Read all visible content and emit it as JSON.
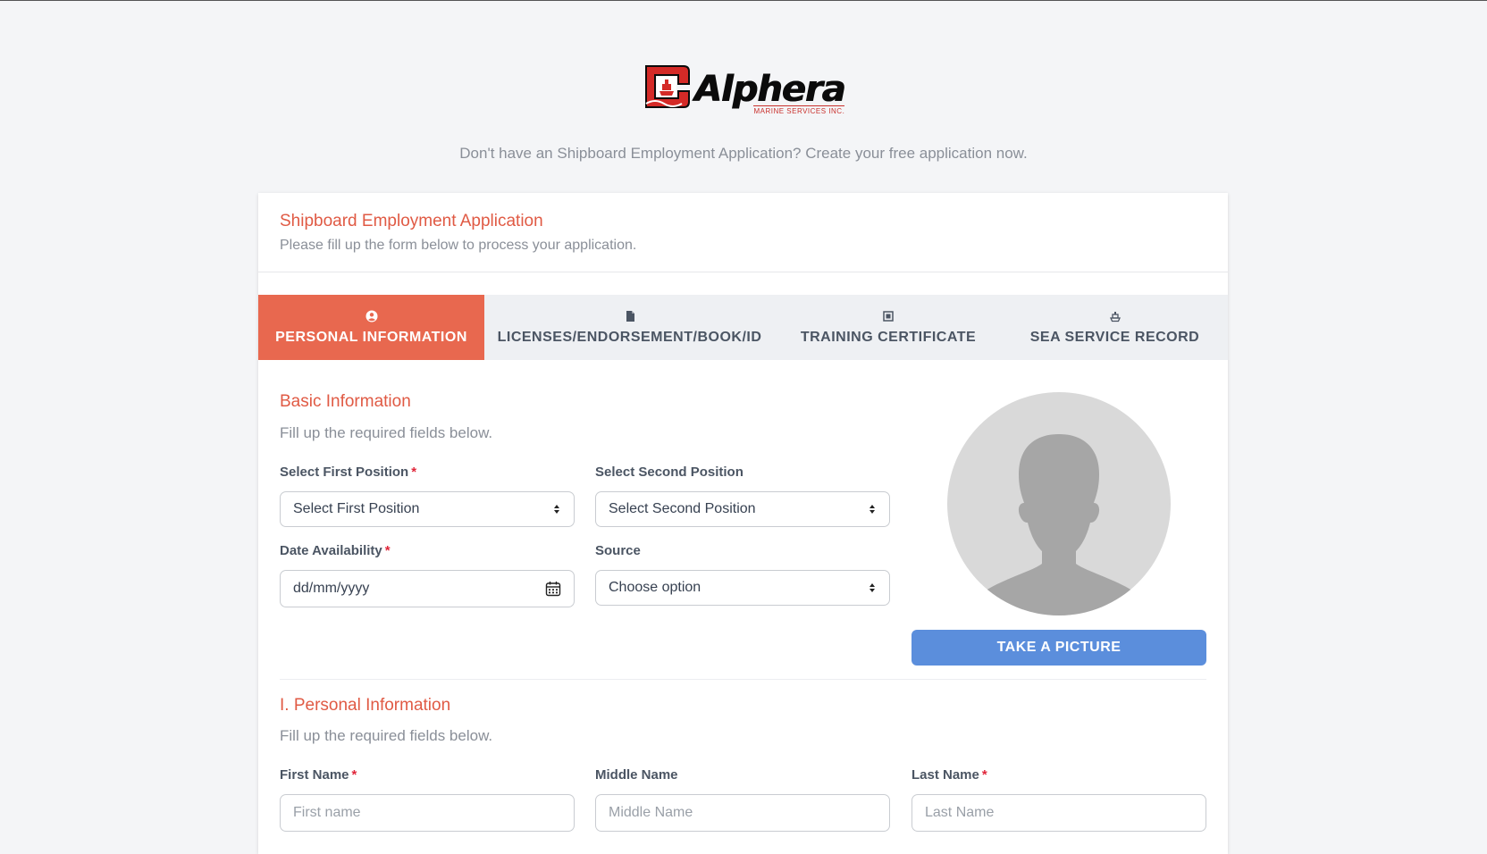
{
  "brand": {
    "name": "Alphera",
    "subname": "MARINE SERVICES INC.",
    "colors": {
      "red": "#d42a27",
      "black": "#0b0b0b"
    }
  },
  "tagline": "Don't have an Shipboard Employment Application? Create your free application now.",
  "card": {
    "title": "Shipboard Employment Application",
    "subtitle": "Please fill up the form below to process your application."
  },
  "tabs": [
    {
      "label": "PERSONAL INFORMATION",
      "icon": "user-circle-icon",
      "active": true
    },
    {
      "label": "LICENSES/ENDORSEMENT/BOOK/ID",
      "icon": "document-icon",
      "active": false
    },
    {
      "label": "TRAINING CERTIFICATE",
      "icon": "certificate-icon",
      "active": false
    },
    {
      "label": "SEA SERVICE RECORD",
      "icon": "ship-icon",
      "active": false
    }
  ],
  "basic": {
    "title": "Basic Information",
    "subtitle": "Fill up the required fields below.",
    "first_position": {
      "label": "Select First Position",
      "required": "*",
      "value": "Select First Position"
    },
    "second_position": {
      "label": "Select Second Position",
      "value": "Select Second Position"
    },
    "date_availability": {
      "label": "Date Availability",
      "required": "*",
      "value": "dd/mm/yyyy"
    },
    "source": {
      "label": "Source",
      "value": "Choose option"
    },
    "take_picture": "TAKE A PICTURE"
  },
  "personal": {
    "title": "I. Personal Information",
    "subtitle": "Fill up the required fields below.",
    "first_name": {
      "label": "First Name",
      "required": "*",
      "placeholder": "First name"
    },
    "middle_name": {
      "label": "Middle Name",
      "placeholder": "Middle Name"
    },
    "last_name": {
      "label": "Last Name",
      "required": "*",
      "placeholder": "Last Name"
    }
  },
  "colors": {
    "accent": "#e8684f",
    "heading": "#e05a44",
    "button": "#5b8edc",
    "required": "#e0263a"
  }
}
